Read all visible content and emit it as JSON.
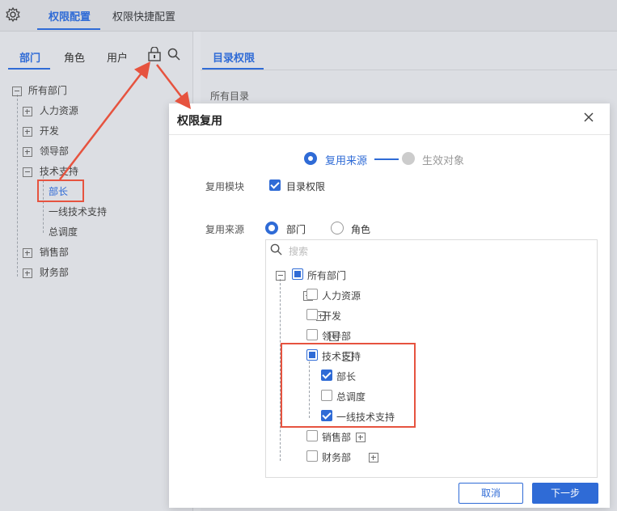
{
  "top_tabs": [
    "权限配置",
    "权限快捷配置"
  ],
  "left_tabs": [
    "部门",
    "角色",
    "用户"
  ],
  "left_tree": {
    "root": "所有部门",
    "children": [
      "人力资源",
      "开发",
      "领导部",
      "技术支持",
      "销售部",
      "财务部"
    ],
    "tech_children": [
      "部长",
      "一线技术支持",
      "总调度"
    ]
  },
  "right_tab": "目录权限",
  "right_all_dir": "所有目录",
  "dialog": {
    "title": "权限复用",
    "step1": "复用来源",
    "step2": "生效对象",
    "module_label": "复用模块",
    "module_option": "目录权限",
    "source_label": "复用来源",
    "source_option_dept": "部门",
    "source_option_role": "角色",
    "search_placeholder": "搜索",
    "tree": {
      "root": "所有部门",
      "hr": "人力资源",
      "dev": "开发",
      "lead": "领导部",
      "tech": "技术支持",
      "tech_children": [
        "部长",
        "总调度",
        "一线技术支持"
      ],
      "sales": "销售部",
      "finance": "财务部"
    },
    "cancel": "取消",
    "next": "下一步"
  },
  "colors": {
    "accent": "#2f6bd6",
    "highlight": "#e6533f"
  },
  "icons": [
    "gear-icon",
    "lock-copy-icon",
    "search-icon",
    "close-icon"
  ]
}
